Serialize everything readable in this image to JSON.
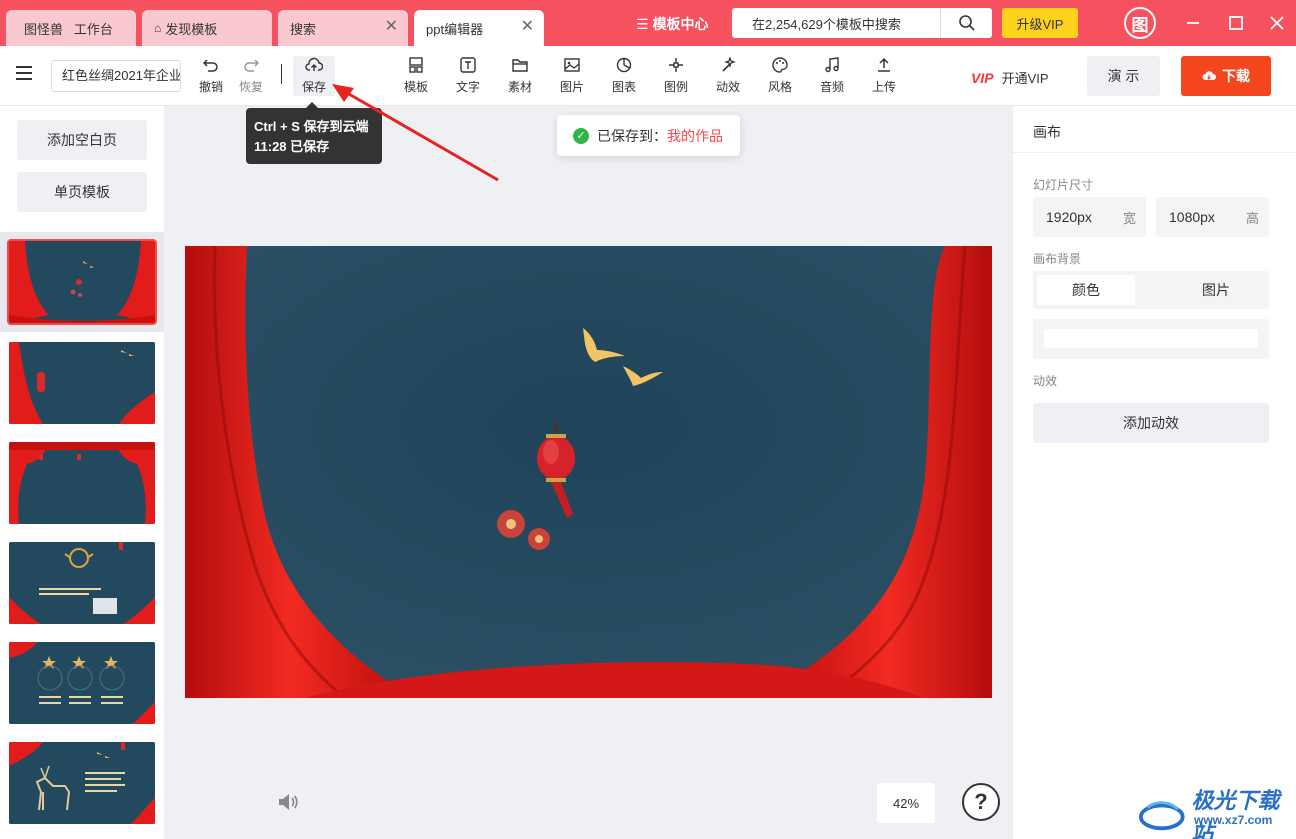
{
  "titlebar": {
    "tabs": [
      {
        "label": "图怪兽   工作台"
      },
      {
        "label": "发现模板"
      },
      {
        "label": "搜索"
      },
      {
        "label": "ppt编辑器"
      }
    ],
    "center_label": "模板中心",
    "search_placeholder": "在2,254,629个模板中搜索",
    "vip_button": "升级VIP",
    "logo_char": "图",
    "brand_color": "#f5515f"
  },
  "toolbar": {
    "doc_name": "红色丝绸2021年企业",
    "undo": "撤销",
    "redo": "恢复",
    "save": "保存",
    "tools": [
      "模板",
      "文字",
      "素材",
      "图片",
      "图表",
      "图例",
      "动效",
      "风格",
      "音频",
      "上传"
    ],
    "vip_mark": "VIP",
    "vip_open": "开通VIP",
    "present": "演 示",
    "download": "下载"
  },
  "tooltip": {
    "line1": "Ctrl + S 保存到云端",
    "line2": "11:28 已保存"
  },
  "toast": {
    "text": "已保存到：",
    "link": "我的作品"
  },
  "left_panel": {
    "add_blank": "添加空白页",
    "single_template": "单页模板"
  },
  "canvas": {
    "zoom": "42%",
    "help": "?"
  },
  "right_panel": {
    "title": "画布",
    "size_label": "幻灯片尺寸",
    "width_value": "1920px",
    "width_unit": "宽",
    "height_value": "1080px",
    "height_unit": "高",
    "bg_label": "画布背景",
    "bg_options": [
      "颜色",
      "图片"
    ],
    "effect_label": "动效",
    "add_effect": "添加动效"
  },
  "watermark": {
    "text": "极光下载站",
    "url": "www.xz7.com"
  }
}
